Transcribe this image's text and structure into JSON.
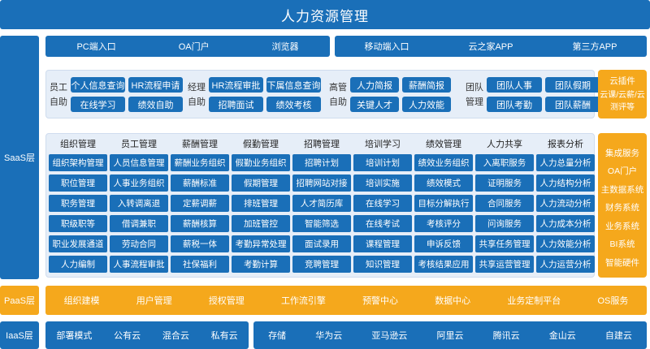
{
  "title": "人力资源管理",
  "layers": {
    "saas": "SaaS层",
    "paas": "PaaS层",
    "iaas": "IaaS层"
  },
  "entry_left": [
    "PC端入口",
    "OA门户",
    "浏览器"
  ],
  "entry_right": [
    "移动端入口",
    "云之家APP",
    "第三方APP"
  ],
  "self_service": [
    {
      "label": "员工自助",
      "items": [
        "个人信息查询",
        "HR流程申请",
        "在线学习",
        "绩效自助"
      ]
    },
    {
      "label": "经理自助",
      "items": [
        "HR流程审批",
        "下属信息查询",
        "招聘面试",
        "绩效考核"
      ]
    },
    {
      "label": "高管自助",
      "items": [
        "人力简报",
        "薪酬简报",
        "关键人才",
        "人力效能"
      ]
    },
    {
      "label": "团队管理",
      "items": [
        "团队人事",
        "团队假期",
        "团队考勤",
        "团队薪酬"
      ]
    }
  ],
  "plugins": {
    "title": "云插件",
    "text": "云课/云薪/云测评等"
  },
  "modules": [
    {
      "name": "组织管理",
      "items": [
        "组织架构管理",
        "职位管理",
        "职务管理",
        "职级职等",
        "职业发展通道",
        "人力编制"
      ]
    },
    {
      "name": "员工管理",
      "items": [
        "人员信息管理",
        "人事业务组织",
        "入转调离退",
        "借调兼职",
        "劳动合同",
        "人事流程审批"
      ]
    },
    {
      "name": "薪酬管理",
      "items": [
        "薪酬业务组织",
        "薪酬标准",
        "定薪调薪",
        "薪酬核算",
        "薪税一体",
        "社保福利"
      ]
    },
    {
      "name": "假勤管理",
      "items": [
        "假勤业务组织",
        "假期管理",
        "排班管理",
        "加班管控",
        "考勤异常处理",
        "考勤计算"
      ]
    },
    {
      "name": "招聘管理",
      "items": [
        "招聘计划",
        "招聘网站对接",
        "人才简历库",
        "智能筛选",
        "面试录用",
        "竞聘管理"
      ]
    },
    {
      "name": "培训学习",
      "items": [
        "培训计划",
        "培训实施",
        "在线学习",
        "在线考试",
        "课程管理",
        "知识管理"
      ]
    },
    {
      "name": "绩效管理",
      "items": [
        "绩效业务组织",
        "绩效模式",
        "目标分解执行",
        "考核评分",
        "申诉反馈",
        "考核结果应用"
      ]
    },
    {
      "name": "人力共享",
      "items": [
        "入离职服务",
        "证明服务",
        "合同服务",
        "问询服务",
        "共享任务管理",
        "共享运营管理"
      ]
    },
    {
      "name": "报表分析",
      "items": [
        "人力总量分析",
        "人力结构分析",
        "人力流动分析",
        "人力成本分析",
        "人力效能分析",
        "人力运营分析"
      ]
    }
  ],
  "integrations": [
    "集成服务",
    "OA门户",
    "主数据系统",
    "财务系统",
    "业务系统",
    "BI系统",
    "智能硬件"
  ],
  "paas_items": [
    "组织建模",
    "用户管理",
    "授权管理",
    "工作流引擎",
    "预警中心",
    "数据中心",
    "业务定制平台",
    "OS服务"
  ],
  "iaas_left": [
    "部署模式",
    "公有云",
    "混合云",
    "私有云"
  ],
  "iaas_right": [
    "存储",
    "华为云",
    "亚马逊云",
    "阿里云",
    "腾讯云",
    "金山云",
    "自建云"
  ]
}
